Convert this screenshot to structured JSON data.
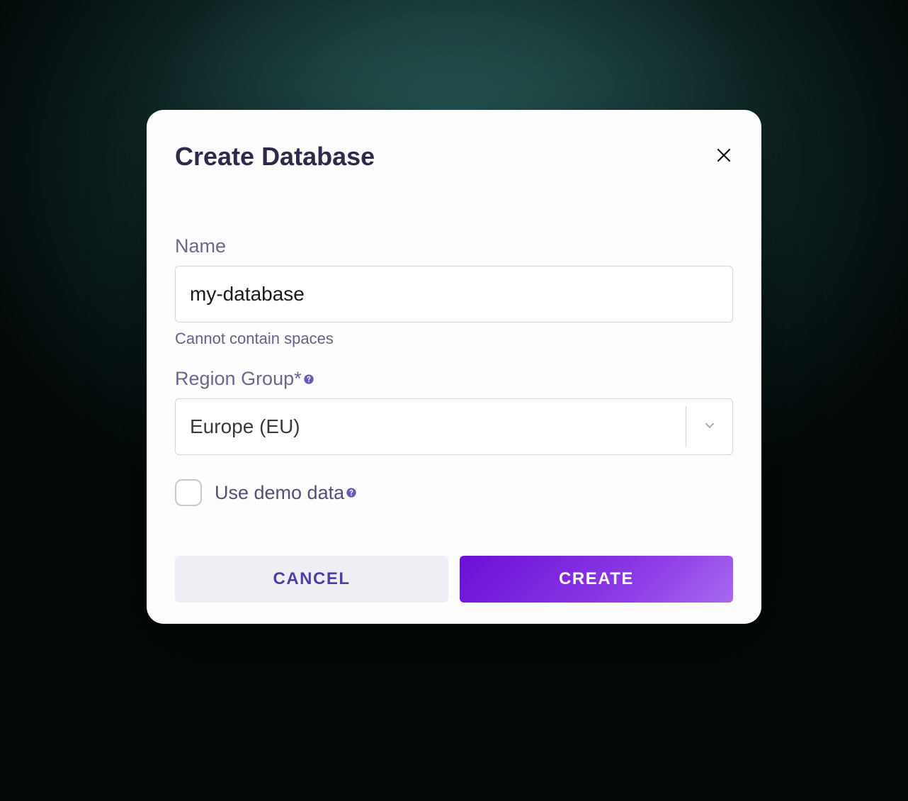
{
  "modal": {
    "title": "Create Database",
    "name": {
      "label": "Name",
      "value": "my-database",
      "helper": "Cannot contain spaces"
    },
    "region": {
      "label": "Region Group*",
      "selected": "Europe (EU)"
    },
    "demo": {
      "label": "Use demo data",
      "checked": false
    },
    "actions": {
      "cancel": "CANCEL",
      "create": "CREATE"
    }
  }
}
